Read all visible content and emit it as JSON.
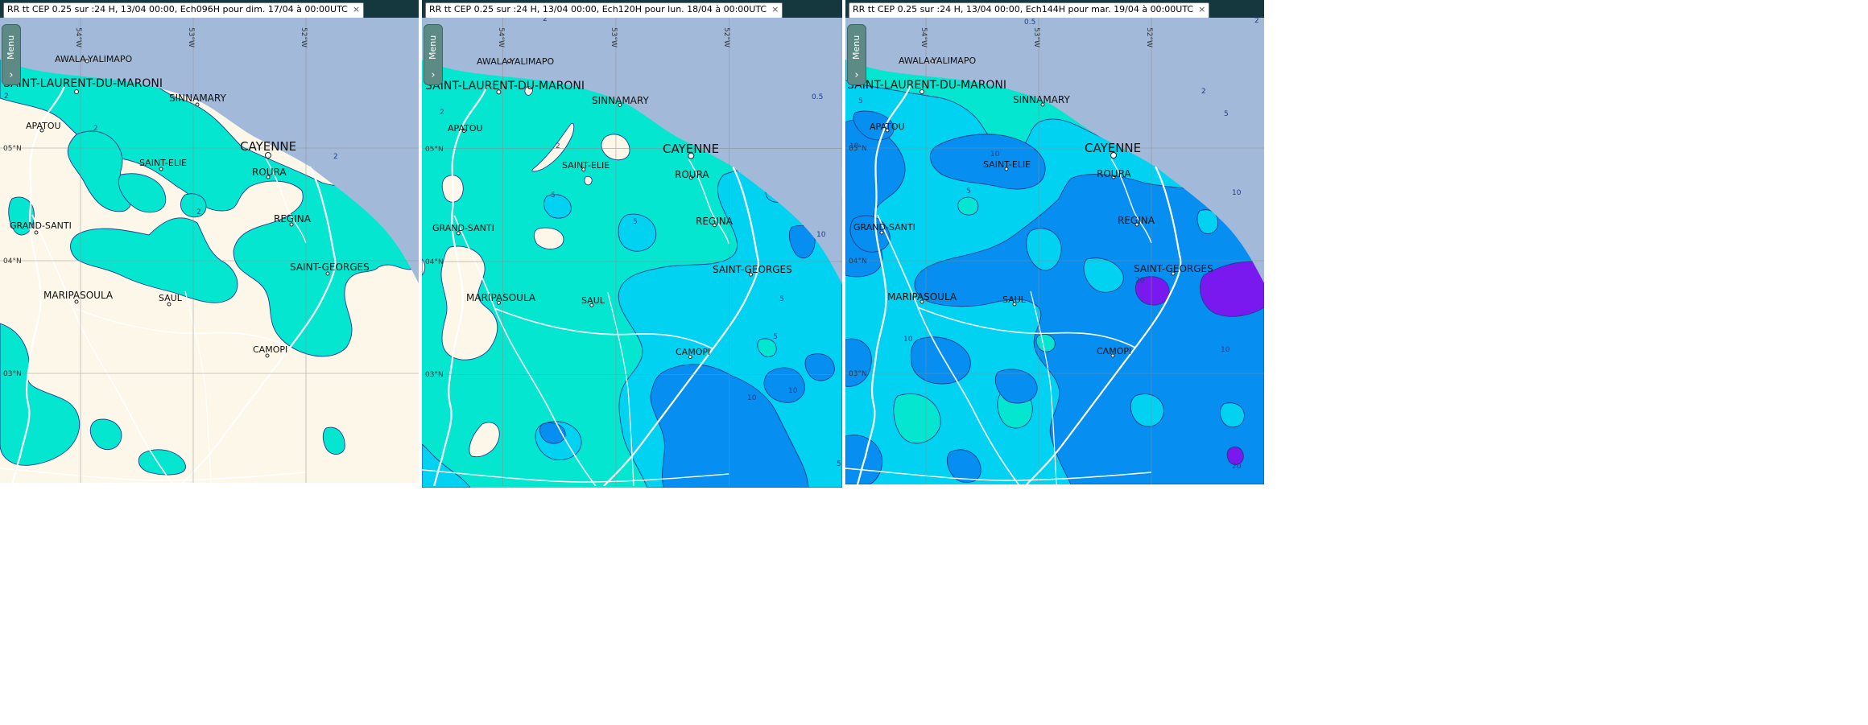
{
  "panels": [
    {
      "title": "RR tt CEP 0.25 sur :24 H, 13/04 00:00, Ech096H pour dim. 17/04 à 00:00UTC",
      "close_symbol": "×",
      "menu_label": "Menu"
    },
    {
      "title": "RR tt CEP 0.25 sur :24 H, 13/04 00:00, Ech120H pour lun. 18/04 à 00:00UTC",
      "close_symbol": "×",
      "menu_label": "Menu"
    },
    {
      "title": "RR tt CEP 0.25 sur :24 H, 13/04 00:00, Ech144H pour mar. 19/04 à 00:00UTC",
      "close_symbol": "×",
      "menu_label": "Menu"
    }
  ],
  "grid": {
    "lon_labels": [
      "54°W",
      "53°W",
      "52°W"
    ],
    "lat_labels": [
      "05°N",
      "04°N",
      "03°N"
    ]
  },
  "towns": {
    "awala": "AWALA-YALIMAPO",
    "saint_laurent": "SAINT-LAURENT-DU-MARONI",
    "sinnamary": "SINNAMARY",
    "apatou": "APATOU",
    "cayenne": "CAYENNE",
    "saint_elie": "SAINT-ELIE",
    "roura": "ROURA",
    "grand_santi": "GRAND-SANTI",
    "regina": "REGINA",
    "saint_georges": "SAINT-GEORGES",
    "maripasoula": "MARIPASOULA",
    "saul": "SAUL",
    "camopi": "CAMOPI"
  },
  "contour_labels": {
    "p1": [
      "2",
      "2",
      "2",
      "2"
    ],
    "p2": [
      "2",
      "2",
      "2",
      "5",
      "5",
      "0.5",
      "10",
      "5",
      "5",
      "10",
      "10",
      "5"
    ],
    "p3": [
      "0.5",
      "5",
      "2",
      "10",
      "10",
      "5",
      "10",
      "10",
      "20",
      "10",
      "10",
      "20",
      "5",
      "2",
      "5"
    ]
  },
  "colors": {
    "sea": "#a3b9d9",
    "land_dry": "#fdf7e9",
    "rr_2": "#05e6d1",
    "rr_5": "#02d2f2",
    "rr_10": "#068ef0",
    "rr_20": "#7a18f0",
    "contour": "#1e3d8c",
    "river": "#ffffff",
    "title_bar": "#15383f"
  }
}
